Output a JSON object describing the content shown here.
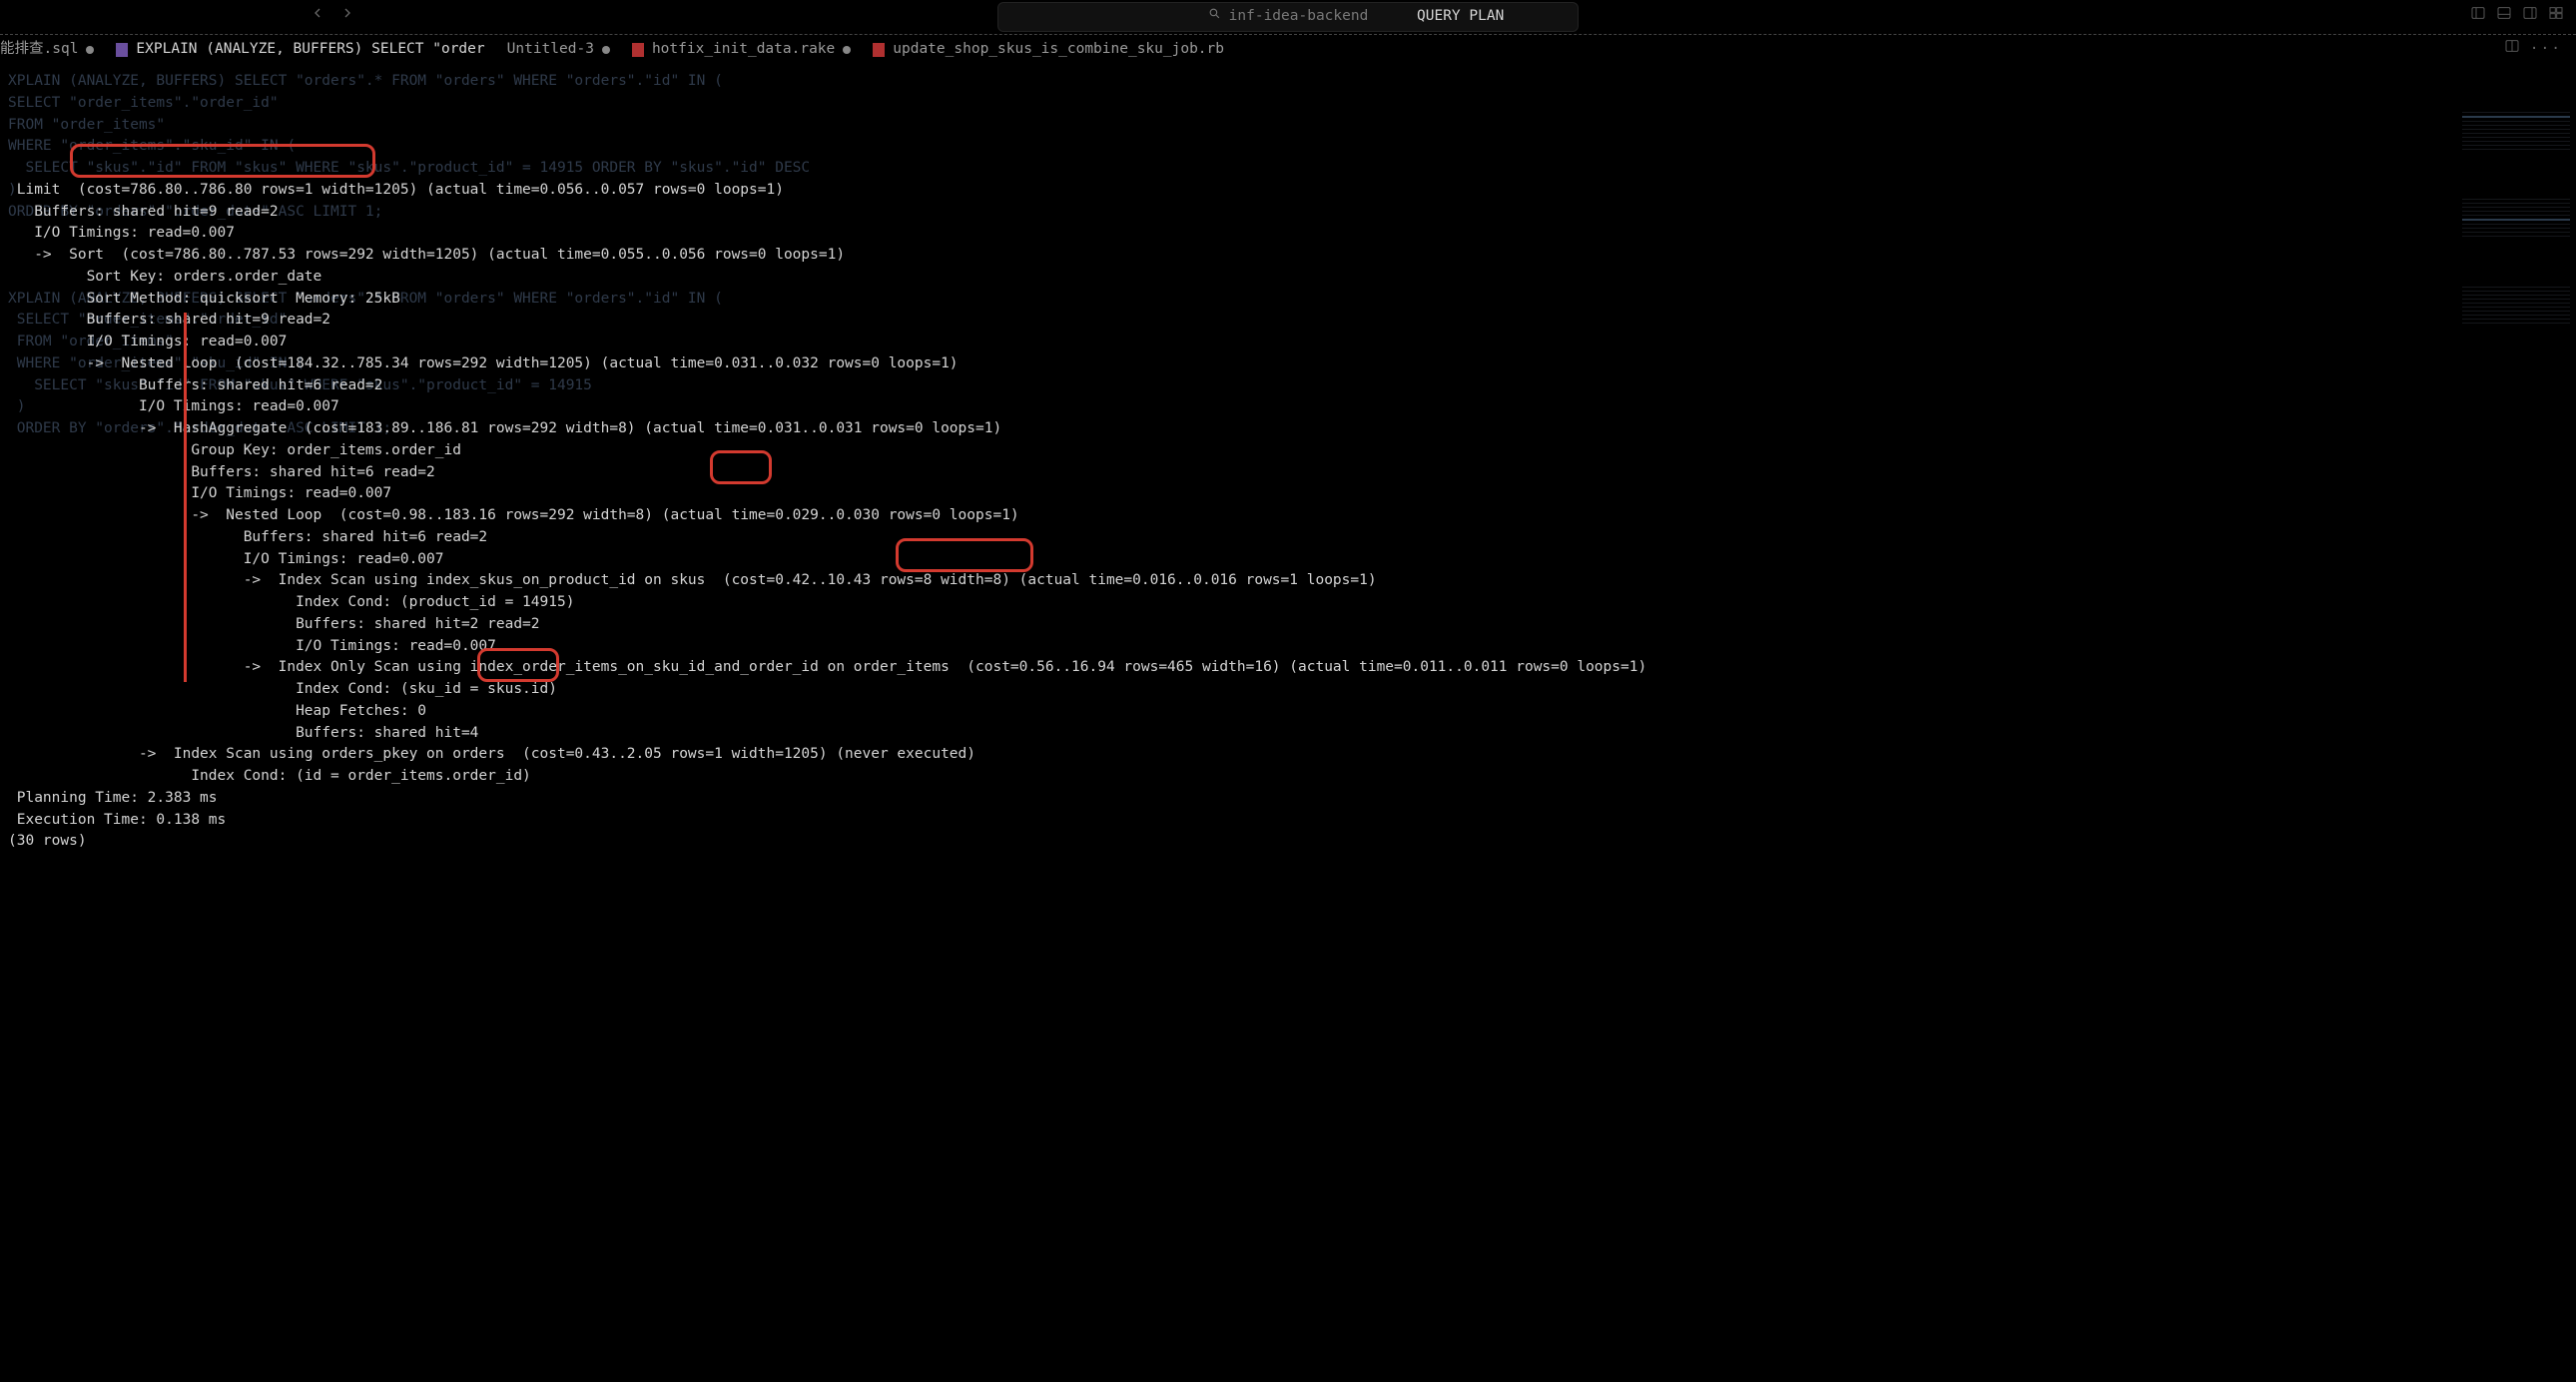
{
  "titlebar": {
    "search_placeholder": "inf-idea-backend",
    "center_label": "QUERY PLAN"
  },
  "tabs": [
    {
      "label": "能排查.sql"
    },
    {
      "label": "EXPLAIN (ANALYZE, BUFFERS) SELECT \"order"
    },
    {
      "label": "Untitled-3"
    },
    {
      "label": "hotfix_init_data.rake"
    },
    {
      "label": "update_shop_skus_is_combine_sku_job.rb"
    }
  ],
  "ghost_sql": "XPLAIN (ANALYZE, BUFFERS) SELECT \"orders\".* FROM \"orders\" WHERE \"orders\".\"id\" IN (\nSELECT \"order_items\".\"order_id\"\nFROM \"order_items\"\nWHERE \"order_items\".\"sku_id\" IN (\n  SELECT \"skus\".\"id\" FROM \"skus\" WHERE \"skus\".\"product_id\" = 14915 ORDER BY \"skus\".\"id\" DESC\n)\nORDER BY \"orders\".\"order_date\" ASC LIMIT 1;\n\n\n\nXPLAIN (ANALYZE, BUFFERS) SELECT \"orders\".* FROM \"orders\" WHERE \"orders\".\"id\" IN (\n SELECT \"order_items\".\"order_id\"\n FROM \"order_items\"\n WHERE \"order_items\".\"sku_id\" IN (\n   SELECT \"skus\".\"id\" FROM \"skus\" WHERE \"skus\".\"product_id\" = 14915\n )\n ORDER BY \"orders\".\"order_date\" ASC LIMIT 1;",
  "plan_lines": [
    " Limit  (cost=786.80..786.80 rows=1 width=1205) (actual time=0.056..0.057 rows=0 loops=1)",
    "   Buffers: shared hit=9 read=2",
    "   I/O Timings: read=0.007",
    "   ->  Sort  (cost=786.80..787.53 rows=292 width=1205) (actual time=0.055..0.056 rows=0 loops=1)",
    "         Sort Key: orders.order_date",
    "         Sort Method: quicksort  Memory: 25kB",
    "         Buffers: shared hit=9 read=2",
    "         I/O Timings: read=0.007",
    "         ->  Nested Loop  (cost=184.32..785.34 rows=292 width=1205) (actual time=0.031..0.032 rows=0 loops=1)",
    "               Buffers: shared hit=6 read=2",
    "               I/O Timings: read=0.007",
    "               ->  HashAggregate  (cost=183.89..186.81 rows=292 width=8) (actual time=0.031..0.031 rows=0 loops=1)",
    "                     Group Key: order_items.order_id",
    "                     Buffers: shared hit=6 read=2",
    "                     I/O Timings: read=0.007",
    "                     ->  Nested Loop  (cost=0.98..183.16 rows=292 width=8) (actual time=0.029..0.030 rows=0 loops=1)",
    "                           Buffers: shared hit=6 read=2",
    "                           I/O Timings: read=0.007",
    "                           ->  Index Scan using index_skus_on_product_id on skus  (cost=0.42..10.43 rows=8 width=8) (actual time=0.016..0.016 rows=1 loops=1)",
    "                                 Index Cond: (product_id = 14915)",
    "                                 Buffers: shared hit=2 read=2",
    "                                 I/O Timings: read=0.007",
    "                           ->  Index Only Scan using index_order_items_on_sku_id_and_order_id on order_items  (cost=0.56..16.94 rows=465 width=16) (actual time=0.011..0.011 rows=0 loops=1)",
    "                                 Index Cond: (sku_id = skus.id)",
    "                                 Heap Fetches: 0",
    "                                 Buffers: shared hit=4",
    "               ->  Index Scan using orders_pkey on orders  (cost=0.43..2.05 rows=1 width=1205) (never executed)",
    "                     Index Cond: (id = order_items.order_id)",
    " Planning Time: 2.383 ms",
    " Execution Time: 0.138 ms",
    "(30 rows)"
  ],
  "annotations": {
    "sort_key_box": "Sort Key: orders.order_date",
    "skus_box": "skus",
    "order_items_box": "order_items",
    "orders_box": "orders"
  }
}
